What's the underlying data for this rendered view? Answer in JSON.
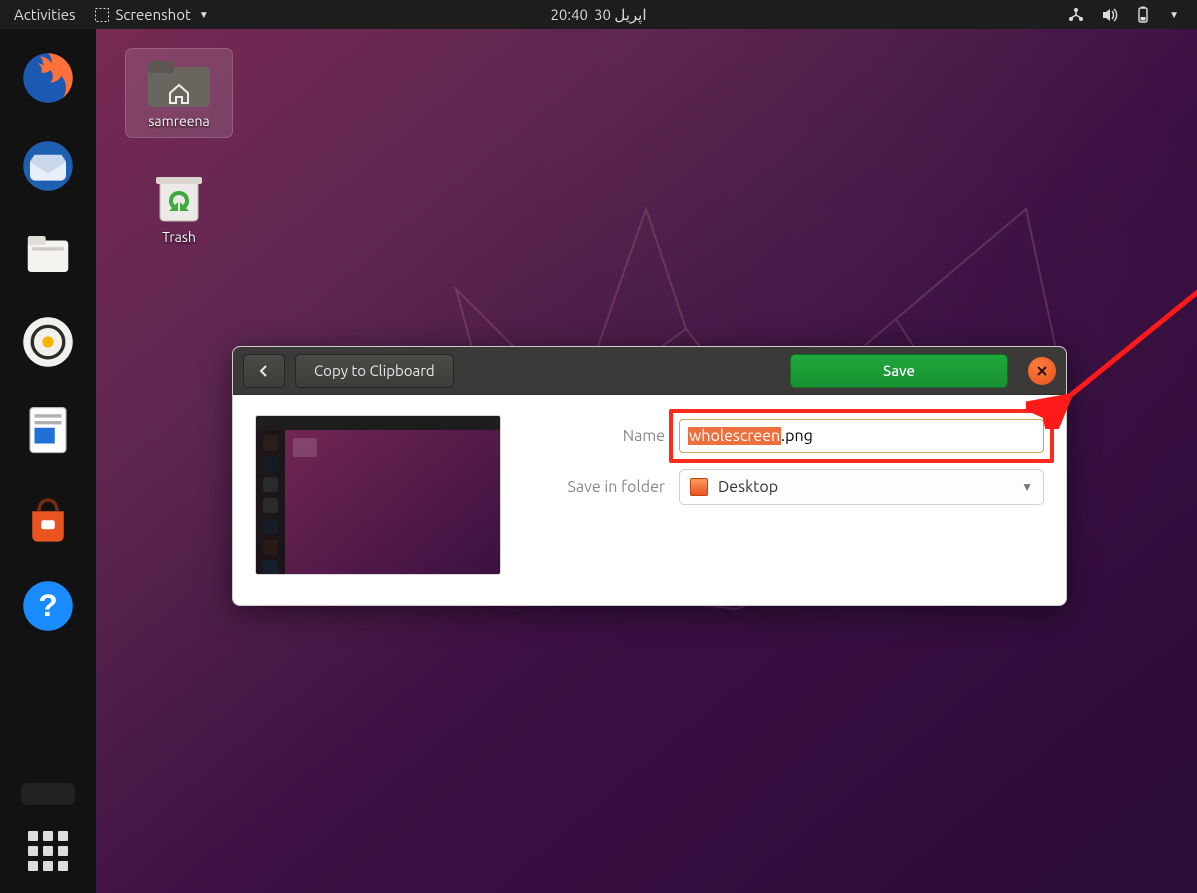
{
  "panel": {
    "activities": "Activities",
    "app_name": "Screenshot",
    "clock": "20:40",
    "date_extra": "اپریل 30"
  },
  "desktop_icons": {
    "home": "samreena",
    "trash": "Trash"
  },
  "dialog": {
    "copy_label": "Copy to Clipboard",
    "save_label": "Save",
    "name_label": "Name",
    "folder_label": "Save in folder",
    "name_selected": "wholescreen",
    "name_suffix": ".png",
    "folder_value": "Desktop"
  },
  "dock": {
    "items": [
      "firefox",
      "thunderbird",
      "files",
      "rhythmbox",
      "writer",
      "software",
      "help"
    ]
  }
}
